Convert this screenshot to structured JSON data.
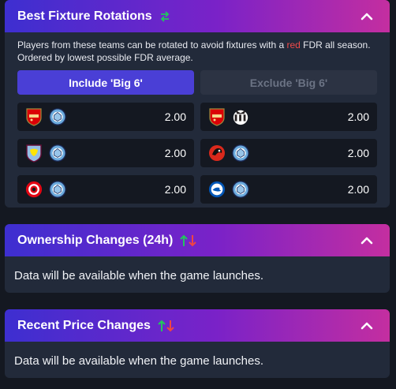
{
  "fixtures": {
    "title": "Best Fixture Rotations",
    "description_pre": "Players from these teams can be rotated to avoid fixtures with a ",
    "description_red": "red",
    "description_post": " FDR all season. Ordered by lowest possible FDR average.",
    "tabs": [
      {
        "label": "Include 'Big 6'",
        "active": true
      },
      {
        "label": "Exclude 'Big 6'",
        "active": false
      }
    ],
    "rotations": [
      {
        "teams": [
          "Arsenal",
          "Man City"
        ],
        "avg": "2.00"
      },
      {
        "teams": [
          "Arsenal",
          "Newcastle"
        ],
        "avg": "2.00"
      },
      {
        "teams": [
          "Aston Villa",
          "Man City"
        ],
        "avg": "2.00"
      },
      {
        "teams": [
          "Bournemouth",
          "Man City"
        ],
        "avg": "2.00"
      },
      {
        "teams": [
          "Brentford",
          "Man City"
        ],
        "avg": "2.00"
      },
      {
        "teams": [
          "Brighton",
          "Man City"
        ],
        "avg": "2.00"
      }
    ]
  },
  "ownership": {
    "title": "Ownership Changes (24h)",
    "message": "Data will be available when the game launches."
  },
  "prices": {
    "title": "Recent Price Changes",
    "message": "Data will be available when the game launches."
  },
  "colors": {
    "accent": "#4a3fd6",
    "up": "#22c55e",
    "down": "#ef4444",
    "panel_bg": "#222a3a",
    "page_bg": "#141821"
  }
}
